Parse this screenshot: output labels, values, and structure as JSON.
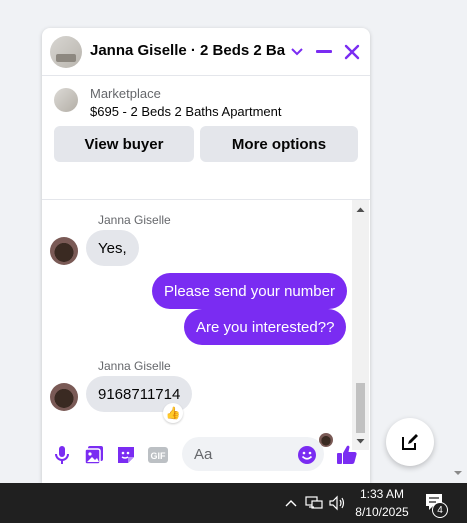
{
  "chat": {
    "title": "Janna Giselle · 2 Beds 2 Ba...",
    "marketplace_label": "Marketplace",
    "listing": "$695 - 2 Beds 2 Baths Apartment",
    "view_buyer_label": "View buyer",
    "more_options_label": "More options",
    "accent_color": "#7a2cf2"
  },
  "messages": {
    "group1_sender": "Janna Giselle",
    "msg1": "Yes,",
    "msg2": "Please send your number",
    "msg3": "Are you interested??",
    "group2_sender": "Janna Giselle",
    "msg4": "9168711714",
    "msg4_reaction": "👍"
  },
  "composer": {
    "placeholder": "Aa",
    "icons": [
      "microphone-icon",
      "photo-icon",
      "sticker-icon",
      "gif-icon",
      "emoji-icon",
      "like-icon"
    ]
  },
  "taskbar": {
    "time": "1:33 AM",
    "date": "8/10/2025",
    "notification_count": "4"
  }
}
